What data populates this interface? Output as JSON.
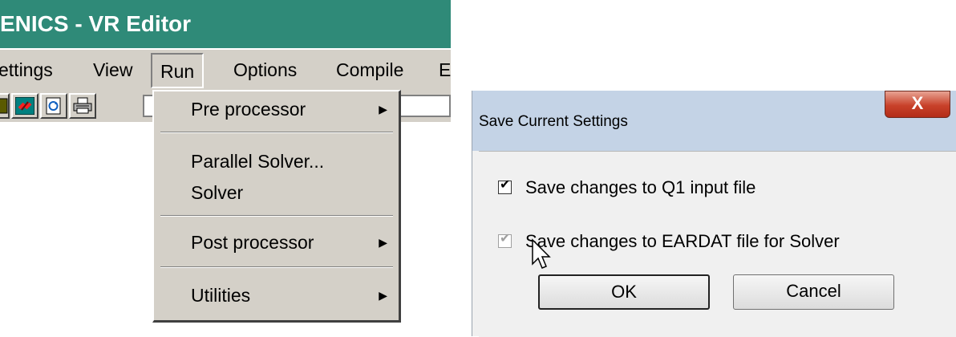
{
  "editor": {
    "title": "ENICS - VR Editor",
    "menu": [
      "ettings",
      "View",
      "Run",
      "Options",
      "Compile",
      "E"
    ],
    "active_menu": "Run",
    "toolbar_icons": [
      "save-icon",
      "link-icon",
      "refresh-icon",
      "print-icon"
    ],
    "run_menu": {
      "items": [
        {
          "label": "Pre processor",
          "submenu": true
        },
        {
          "label": "Parallel Solver...",
          "submenu": false
        },
        {
          "label": "Solver",
          "submenu": false
        },
        {
          "label": "Post processor",
          "submenu": true
        },
        {
          "label": "Utilities",
          "submenu": true
        }
      ]
    }
  },
  "dialog": {
    "title": "Save Current Settings",
    "close_label": "X",
    "options": [
      {
        "label": "Save changes to Q1 input file",
        "checked": true,
        "enabled": true
      },
      {
        "label": "Save changes to EARDAT file for Solver",
        "checked": true,
        "enabled": false
      }
    ],
    "ok_label": "OK",
    "cancel_label": "Cancel"
  },
  "colors": {
    "titlebar": "#2f8a78",
    "menu_bg": "#d4d0c8",
    "dialog_bg": "#f0f0f0",
    "close_button": "#c8412a"
  }
}
